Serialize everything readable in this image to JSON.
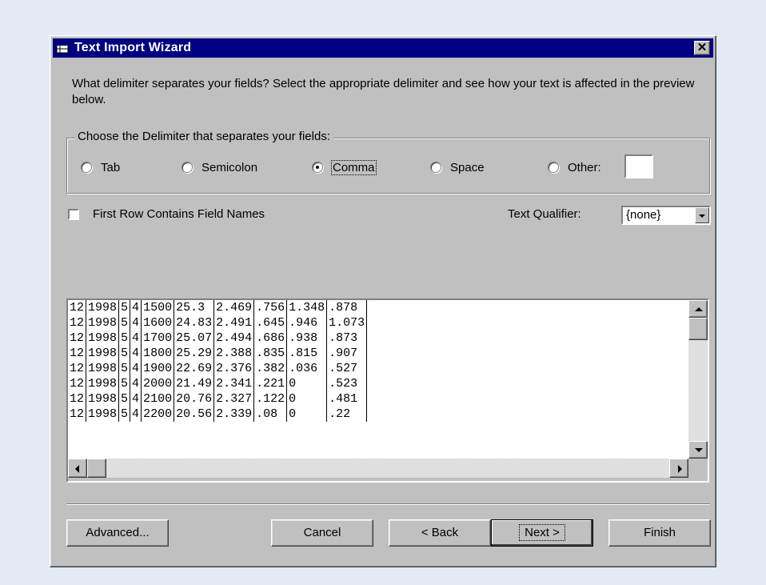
{
  "window": {
    "title": "Text Import Wizard",
    "close_glyph": "✕"
  },
  "intro_text": "What delimiter separates your fields?  Select the appropriate delimiter and see how your text is affected in the preview below.",
  "delimiter_group": {
    "legend": "Choose the Delimiter that separates your fields:",
    "options": [
      {
        "label": "Tab",
        "selected": false
      },
      {
        "label": "Semicolon",
        "selected": false
      },
      {
        "label": "Comma",
        "selected": true
      },
      {
        "label": "Space",
        "selected": false
      },
      {
        "label": "Other:",
        "selected": false
      }
    ],
    "other_value": ""
  },
  "first_row_checkbox": {
    "label": "First Row Contains Field Names",
    "checked": false
  },
  "text_qualifier": {
    "label": "Text Qualifier:",
    "value": "{none}"
  },
  "preview": {
    "rows": [
      [
        "12",
        "1998",
        "5",
        "4",
        "1500",
        "25.3",
        "2.469",
        ".756",
        "1.348",
        ".878"
      ],
      [
        "12",
        "1998",
        "5",
        "4",
        "1600",
        "24.83",
        "2.491",
        ".645",
        ".946",
        "1.073"
      ],
      [
        "12",
        "1998",
        "5",
        "4",
        "1700",
        "25.07",
        "2.494",
        ".686",
        ".938",
        ".873"
      ],
      [
        "12",
        "1998",
        "5",
        "4",
        "1800",
        "25.29",
        "2.388",
        ".835",
        ".815",
        ".907"
      ],
      [
        "12",
        "1998",
        "5",
        "4",
        "1900",
        "22.69",
        "2.376",
        ".382",
        ".036",
        ".527"
      ],
      [
        "12",
        "1998",
        "5",
        "4",
        "2000",
        "21.49",
        "2.341",
        ".221",
        "0",
        ".523"
      ],
      [
        "12",
        "1998",
        "5",
        "4",
        "2100",
        "20.76",
        "2.327",
        ".122",
        "0",
        ".481"
      ],
      [
        "12",
        "1998",
        "5",
        "4",
        "2200",
        "20.56",
        "2.339",
        ".08",
        "0",
        ".22"
      ]
    ]
  },
  "buttons": {
    "advanced": "Advanced...",
    "cancel": "Cancel",
    "back": "< Back",
    "next": "Next >",
    "finish": "Finish"
  }
}
